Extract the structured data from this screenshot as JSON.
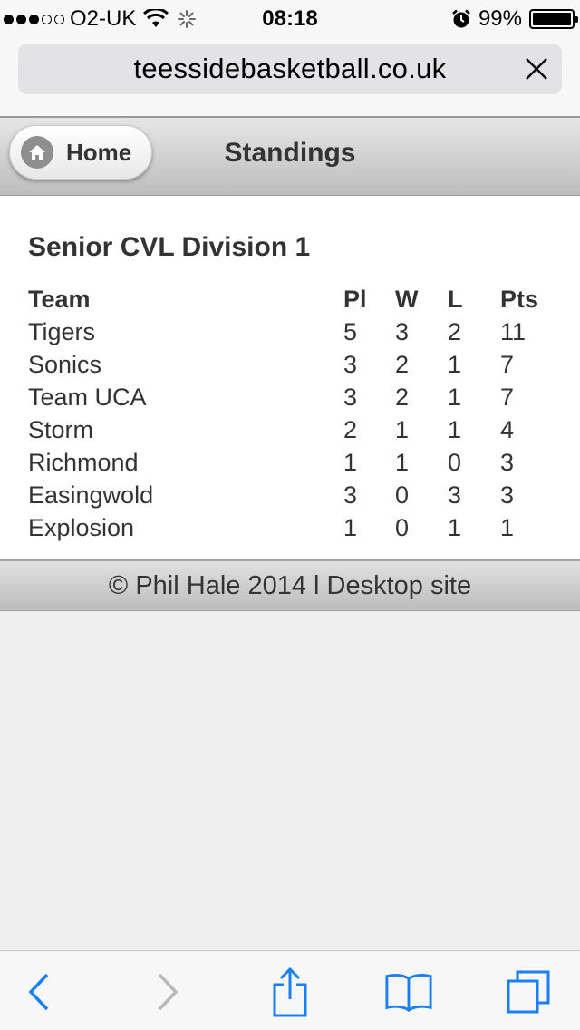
{
  "status_bar": {
    "carrier": "O2-UK",
    "time": "08:18",
    "battery": "99%",
    "battery_level": 0.99
  },
  "browser": {
    "url": "teessidebasketball.co.uk"
  },
  "header": {
    "home_label": "Home",
    "title": "Standings"
  },
  "main": {
    "division_title": "Senior CVL Division 1",
    "columns": [
      "Team",
      "Pl",
      "W",
      "L",
      "Pts"
    ],
    "rows": [
      [
        "Tigers",
        "5",
        "3",
        "2",
        "11"
      ],
      [
        "Sonics",
        "3",
        "2",
        "1",
        "7"
      ],
      [
        "Team UCA",
        "3",
        "2",
        "1",
        "7"
      ],
      [
        "Storm",
        "2",
        "1",
        "1",
        "4"
      ],
      [
        "Richmond",
        "1",
        "1",
        "0",
        "3"
      ],
      [
        "Easingwold",
        "3",
        "0",
        "3",
        "3"
      ],
      [
        "Explosion",
        "1",
        "0",
        "1",
        "1"
      ]
    ]
  },
  "footer": {
    "text": "© Phil Hale 2014 l Desktop site"
  },
  "toolbar": {
    "icons": [
      "back-icon",
      "forward-icon",
      "share-icon",
      "bookmarks-icon",
      "tabs-icon"
    ],
    "accent": "#1a7ef5",
    "disabled": "#b8b8b8"
  }
}
